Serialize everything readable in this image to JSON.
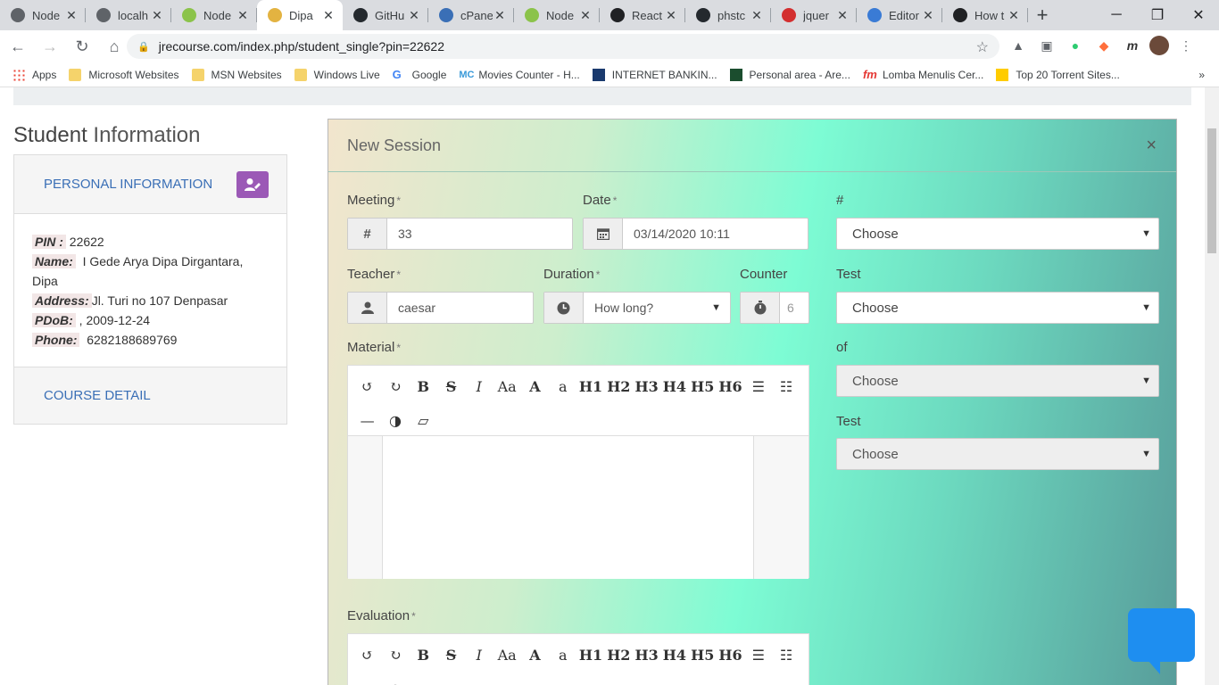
{
  "browser": {
    "tabs": [
      {
        "label": "Node",
        "color": "#5f6368"
      },
      {
        "label": "localh",
        "color": "#5f6368"
      },
      {
        "label": "Node",
        "color": "#8bc34a"
      },
      {
        "label": "Dipa",
        "color": "#e3b341",
        "active": true
      },
      {
        "label": "GitHu",
        "color": "#24292e"
      },
      {
        "label": "cPane",
        "color": "#3a6fb6"
      },
      {
        "label": "Node",
        "color": "#8bc34a"
      },
      {
        "label": "React",
        "color": "#202124"
      },
      {
        "label": "phstc",
        "color": "#24292e"
      },
      {
        "label": "jquer",
        "color": "#d32f2f"
      },
      {
        "label": "Editor",
        "color": "#3a7bd5"
      },
      {
        "label": "How t",
        "color": "#202124"
      }
    ],
    "url": "jrecourse.com/index.php/student_single?pin=22622",
    "bookmarks": [
      "Apps",
      "Microsoft Websites",
      "MSN Websites",
      "Windows Live",
      "Google",
      "Movies Counter - H...",
      "INTERNET BANKIN...",
      "Personal area - Are...",
      "Lomba Menulis Cer...",
      "Top 20 Torrent Sites..."
    ]
  },
  "sidebar": {
    "title_a": "Student",
    "title_b": "Information",
    "personal_label": "PERSONAL INFORMATION",
    "pin_key": "PIN :",
    "pin": "22622",
    "name_key": "Name:",
    "name": "I Gede Arya Dipa Dirgantara, Dipa",
    "address_key": "Address:",
    "address": "Jl. Turi no 107 Denpasar",
    "pdob_key": "PDoB:",
    "pdob": ", 2009-12-24",
    "phone_key": "Phone:",
    "phone": "6282188689769",
    "course_label": "COURSE DETAIL"
  },
  "modal": {
    "title": "New Session",
    "close": "×",
    "meeting_label": "Meeting",
    "meeting_value": "33",
    "date_label": "Date",
    "date_value": "03/14/2020 10:11",
    "hash_label": "#",
    "hash_select": "Choose",
    "teacher_label": "Teacher",
    "teacher_value": "caesar",
    "duration_label": "Duration",
    "duration_value": "How long?",
    "counter_label": "Counter",
    "counter_value": "6",
    "test1_label": "Test",
    "test1_select": "Choose",
    "material_label": "Material",
    "of_label": "of",
    "of_select": "Choose",
    "test2_label": "Test",
    "test2_select": "Choose",
    "evaluation_label": "Evaluation",
    "required": "*",
    "toolbar": [
      "↺",
      "↻",
      "B",
      "S",
      "I",
      "Aa",
      "A",
      "a",
      "H1",
      "H2",
      "H3",
      "H4",
      "H5",
      "H6",
      "☰",
      "☷",
      "—",
      "◑",
      "▱"
    ]
  }
}
